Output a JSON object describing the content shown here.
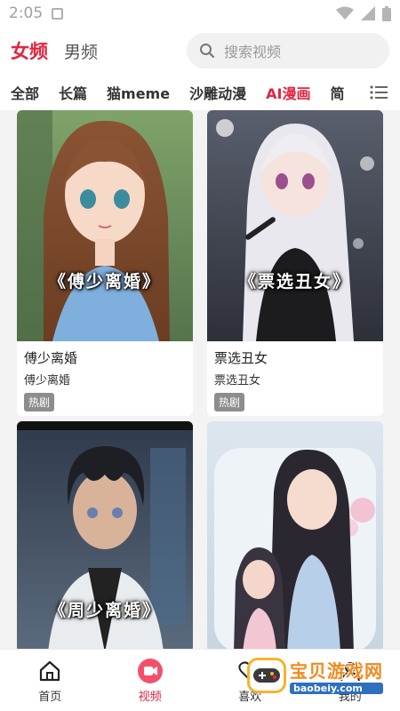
{
  "status_bar": {
    "time": "2:05"
  },
  "header": {
    "tabs": [
      {
        "label": "女频",
        "active": true
      },
      {
        "label": "男频",
        "active": false
      }
    ],
    "search_placeholder": "搜索视频"
  },
  "categories": {
    "items": [
      {
        "label": "全部",
        "active": false
      },
      {
        "label": "长篇",
        "active": false
      },
      {
        "label": "猫meme",
        "active": false
      },
      {
        "label": "沙雕动漫",
        "active": false
      },
      {
        "label": "AI漫画",
        "active": true
      },
      {
        "label": "简",
        "active": false
      }
    ]
  },
  "cards": [
    {
      "cover_title": "《傅少离婚》",
      "title": "傅少离婚",
      "subtitle": "傅少离婚",
      "badge": "热剧"
    },
    {
      "cover_title": "《票选丑女》",
      "title": "票选丑女",
      "subtitle": "票选丑女",
      "badge": "热剧"
    },
    {
      "cover_title": "《周少离婚》"
    },
    {
      "cover_title": ""
    }
  ],
  "bottom_nav": {
    "items": [
      {
        "label": "首页",
        "icon": "home-icon",
        "active": false
      },
      {
        "label": "视频",
        "icon": "video-icon",
        "active": true
      },
      {
        "label": "喜欢",
        "icon": "heart-icon",
        "active": false
      },
      {
        "label": "我的",
        "icon": "profile-icon",
        "active": false
      }
    ]
  },
  "watermark": {
    "main": "宝贝游戏网",
    "sub": "baobeiy.com"
  },
  "colors": {
    "accent": "#e4243f",
    "badge": "#8d8d8d"
  }
}
